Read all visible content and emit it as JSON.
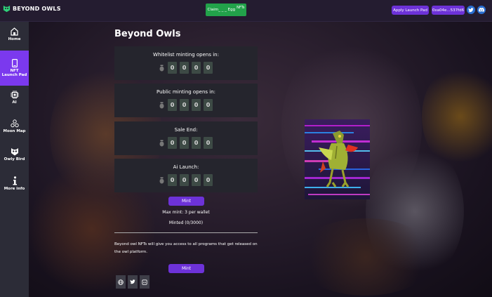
{
  "app": {
    "logo_text": "BEYOND OWLS"
  },
  "header": {
    "claim_button": "Claim_ _ _ Egg",
    "claim_nft_text": "NFTs",
    "apply_button": "Apply Launch Pad",
    "wallet_button": "0xa04e...537fd6",
    "icons": [
      "twitter-icon",
      "discord-icon"
    ]
  },
  "sidebar": {
    "items": [
      {
        "label": "Home",
        "icon": "home-icon"
      },
      {
        "label": "NFT Launch Pad",
        "label_line1": "NFT",
        "label_line2": "Launch Pad",
        "icon": "phone-icon",
        "active": true
      },
      {
        "label": "AI",
        "icon": "chip-icon"
      },
      {
        "label": "Moon Map",
        "icon": "map-icon"
      },
      {
        "label": "Owly Bird",
        "icon": "owl-icon"
      },
      {
        "label": "More info",
        "icon": "info-icon"
      }
    ]
  },
  "main": {
    "title": "Beyond Owls",
    "timers": [
      {
        "label": "Whitelist minting opens in:",
        "digits": [
          "0",
          "0",
          "0",
          "0"
        ]
      },
      {
        "label": "Public minting opens in:",
        "digits": [
          "0",
          "0",
          "0",
          "0"
        ]
      },
      {
        "label": "Sale End:",
        "digits": [
          "0",
          "0",
          "0",
          "0"
        ]
      },
      {
        "label": "Ai Launch:",
        "digits": [
          "0",
          "0",
          "0",
          "0"
        ]
      }
    ],
    "mint_button": "Mint",
    "max_mint": "Max mint: 3 per wallet",
    "minted": "Minted (0/3000)",
    "description": "Beyond owl NFTs will give you access to all programs that get released on the owl platform.",
    "mint_button_2": "Mint",
    "social_icons": [
      "globe-icon",
      "twitter-icon",
      "discord-icon"
    ]
  },
  "colors": {
    "accent": "#6d32d8",
    "sidebar_active": "#7b39ee",
    "claim_green": "#22a24a",
    "card_bg": "#25252d",
    "digit_bg": "#3d4a45"
  }
}
